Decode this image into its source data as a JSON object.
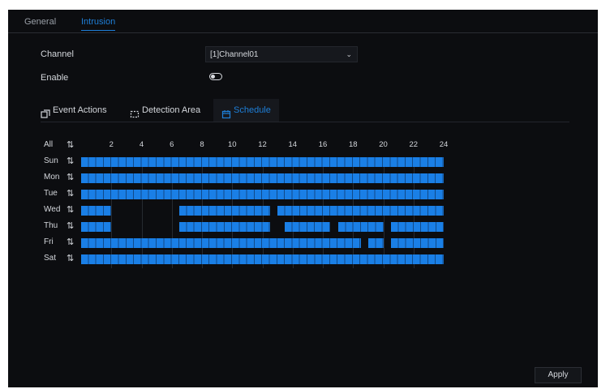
{
  "tabs": [
    {
      "label": "General",
      "active": false
    },
    {
      "label": "Intrusion",
      "active": true
    }
  ],
  "form": {
    "channel_label": "Channel",
    "channel_value": "[1]Channel01",
    "enable_label": "Enable",
    "enable_state": "off"
  },
  "subtabs": [
    {
      "label": "Event Actions",
      "icon": "event-actions-icon",
      "active": false
    },
    {
      "label": "Detection Area",
      "icon": "detection-area-icon",
      "active": false
    },
    {
      "label": "Schedule",
      "icon": "calendar-icon",
      "active": true
    }
  ],
  "schedule": {
    "all_label": "All",
    "hour_labels": [
      "2",
      "4",
      "6",
      "8",
      "10",
      "12",
      "14",
      "16",
      "18",
      "20",
      "22",
      "24"
    ],
    "days": [
      {
        "label": "Sun",
        "segments": [
          [
            0,
            24
          ]
        ]
      },
      {
        "label": "Mon",
        "segments": [
          [
            0,
            24
          ]
        ]
      },
      {
        "label": "Tue",
        "segments": [
          [
            0,
            24
          ]
        ]
      },
      {
        "label": "Wed",
        "segments": [
          [
            0,
            2
          ],
          [
            6.5,
            12.5
          ],
          [
            13,
            24
          ]
        ]
      },
      {
        "label": "Thu",
        "segments": [
          [
            0,
            2
          ],
          [
            6.5,
            12.5
          ],
          [
            13.5,
            16.5
          ],
          [
            17,
            20
          ],
          [
            20.5,
            24
          ]
        ]
      },
      {
        "label": "Fri",
        "segments": [
          [
            0,
            18.5
          ],
          [
            19,
            20
          ],
          [
            20.5,
            24
          ]
        ]
      },
      {
        "label": "Sat",
        "segments": [
          [
            0,
            24
          ]
        ]
      }
    ],
    "accent_color": "#1a7fe6"
  },
  "apply_label": "Apply"
}
